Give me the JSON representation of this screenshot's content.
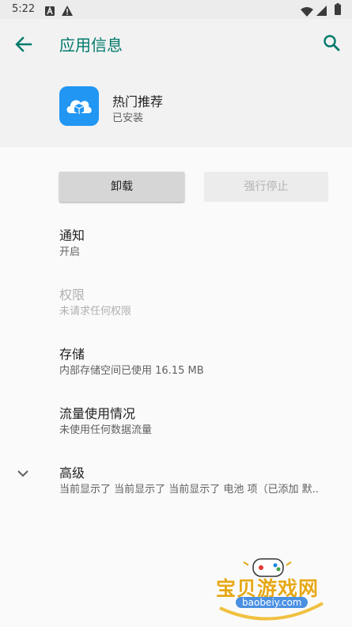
{
  "status_bar": {
    "time": "5:22",
    "icons": [
      "a-notification-icon",
      "warning-icon",
      "wifi-icon",
      "signal-icon",
      "battery-icon"
    ]
  },
  "header": {
    "title": "应用信息",
    "back_icon": "arrow-back-icon",
    "search_icon": "search-icon",
    "accent_color": "#00796b"
  },
  "app": {
    "name": "热门推荐",
    "status": "已安装",
    "icon": "cloud-box-icon",
    "icon_color": "#2196f3"
  },
  "buttons": {
    "uninstall": "卸载",
    "force_stop": "强行停止"
  },
  "settings": [
    {
      "title": "通知",
      "summary": "开启",
      "enabled": true
    },
    {
      "title": "权限",
      "summary": "未请求任何权限",
      "enabled": false
    },
    {
      "title": "存储",
      "summary": "内部存储空间已使用 16.15 MB",
      "enabled": true
    },
    {
      "title": "流量使用情况",
      "summary": "未使用任何数据流量",
      "enabled": true
    },
    {
      "title": "高级",
      "summary": "当前显示了 当前显示了 当前显示了 电池 项（已添加 默..",
      "enabled": true,
      "expand_icon": "chevron-down-icon"
    }
  ],
  "watermark": {
    "text": "宝贝游戏网",
    "url": "baobeiy.com",
    "icon": "gamepad-icon"
  }
}
